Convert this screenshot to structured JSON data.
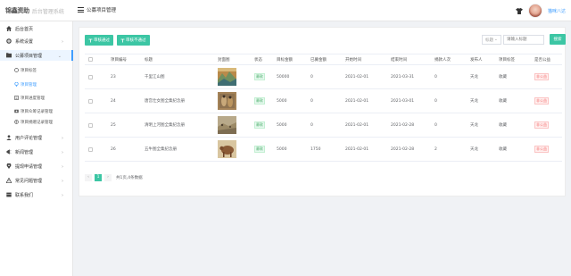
{
  "header": {
    "logo_text": "锦鑫资助",
    "system_name": "后台管理系统",
    "breadcrumb": "公募项目管理",
    "username": "猫咪八达"
  },
  "sidebar": {
    "items": [
      {
        "label": "后台首页",
        "icon": "home-icon"
      },
      {
        "label": "系统设置",
        "icon": "gear-icon"
      },
      {
        "label": "公募项目管理",
        "icon": "folder-icon"
      },
      {
        "label": "用户评论管理",
        "icon": "user-icon"
      },
      {
        "label": "新闻管理",
        "icon": "news-icon"
      },
      {
        "label": "提现申请管理",
        "icon": "location-icon"
      },
      {
        "label": "常见问题管理",
        "icon": "warning-icon"
      },
      {
        "label": "联系我们",
        "icon": "flag-icon"
      }
    ],
    "sub_items": [
      {
        "label": "项目标签",
        "icon": "tag-icon"
      },
      {
        "label": "项目管理",
        "icon": "pin-icon"
      },
      {
        "label": "项目进度管理",
        "icon": "list-icon"
      },
      {
        "label": "项目众筹记录管理",
        "icon": "record-icon"
      },
      {
        "label": "项目捐赠记录管理",
        "icon": "donate-icon"
      }
    ]
  },
  "toolbar": {
    "approve_label": "审核通过",
    "reject_label": "审核不通过",
    "filter_select": "标题",
    "search_placeholder": "请输入标题",
    "search_label": "搜索"
  },
  "table": {
    "columns": [
      "项目编号",
      "标题",
      "封面图",
      "状态",
      "目标金额",
      "已募金额",
      "开始时间",
      "结束时间",
      "捐款人次",
      "发布人",
      "项目标签",
      "是否公益"
    ],
    "rows": [
      {
        "id": "23",
        "title": "千里江山图",
        "status": "募款",
        "target": "50000",
        "raised": "0",
        "start": "2021-02-01",
        "end": "2021-03-31",
        "donors": "0",
        "publisher": "天龙",
        "tag": "收藏",
        "public": "非公益"
      },
      {
        "id": "24",
        "title": "唐宫仕女图全集纪念册",
        "status": "募款",
        "target": "5000",
        "raised": "0",
        "start": "2021-02-01",
        "end": "2021-03-01",
        "donors": "0",
        "publisher": "天龙",
        "tag": "收藏",
        "public": "非公益"
      },
      {
        "id": "25",
        "title": "清明上河图全集纪念册",
        "status": "募款",
        "target": "5000",
        "raised": "0",
        "start": "2021-02-01",
        "end": "2021-02-28",
        "donors": "0",
        "publisher": "天龙",
        "tag": "收藏",
        "public": "非公益"
      },
      {
        "id": "26",
        "title": "五牛图全集纪念册",
        "status": "募款",
        "target": "5000",
        "raised": "1750",
        "start": "2021-02-01",
        "end": "2021-02-28",
        "donors": "2",
        "publisher": "天龙",
        "tag": "收藏",
        "public": "非公益"
      }
    ]
  },
  "pagination": {
    "prev": "‹",
    "current_page": "1",
    "next": "›",
    "total_text": "共1页,4条数据"
  },
  "colors": {
    "accent": "#3cc6a4",
    "link": "#409eff",
    "status_green": "#4cad6b",
    "danger": "#f56c6c"
  }
}
